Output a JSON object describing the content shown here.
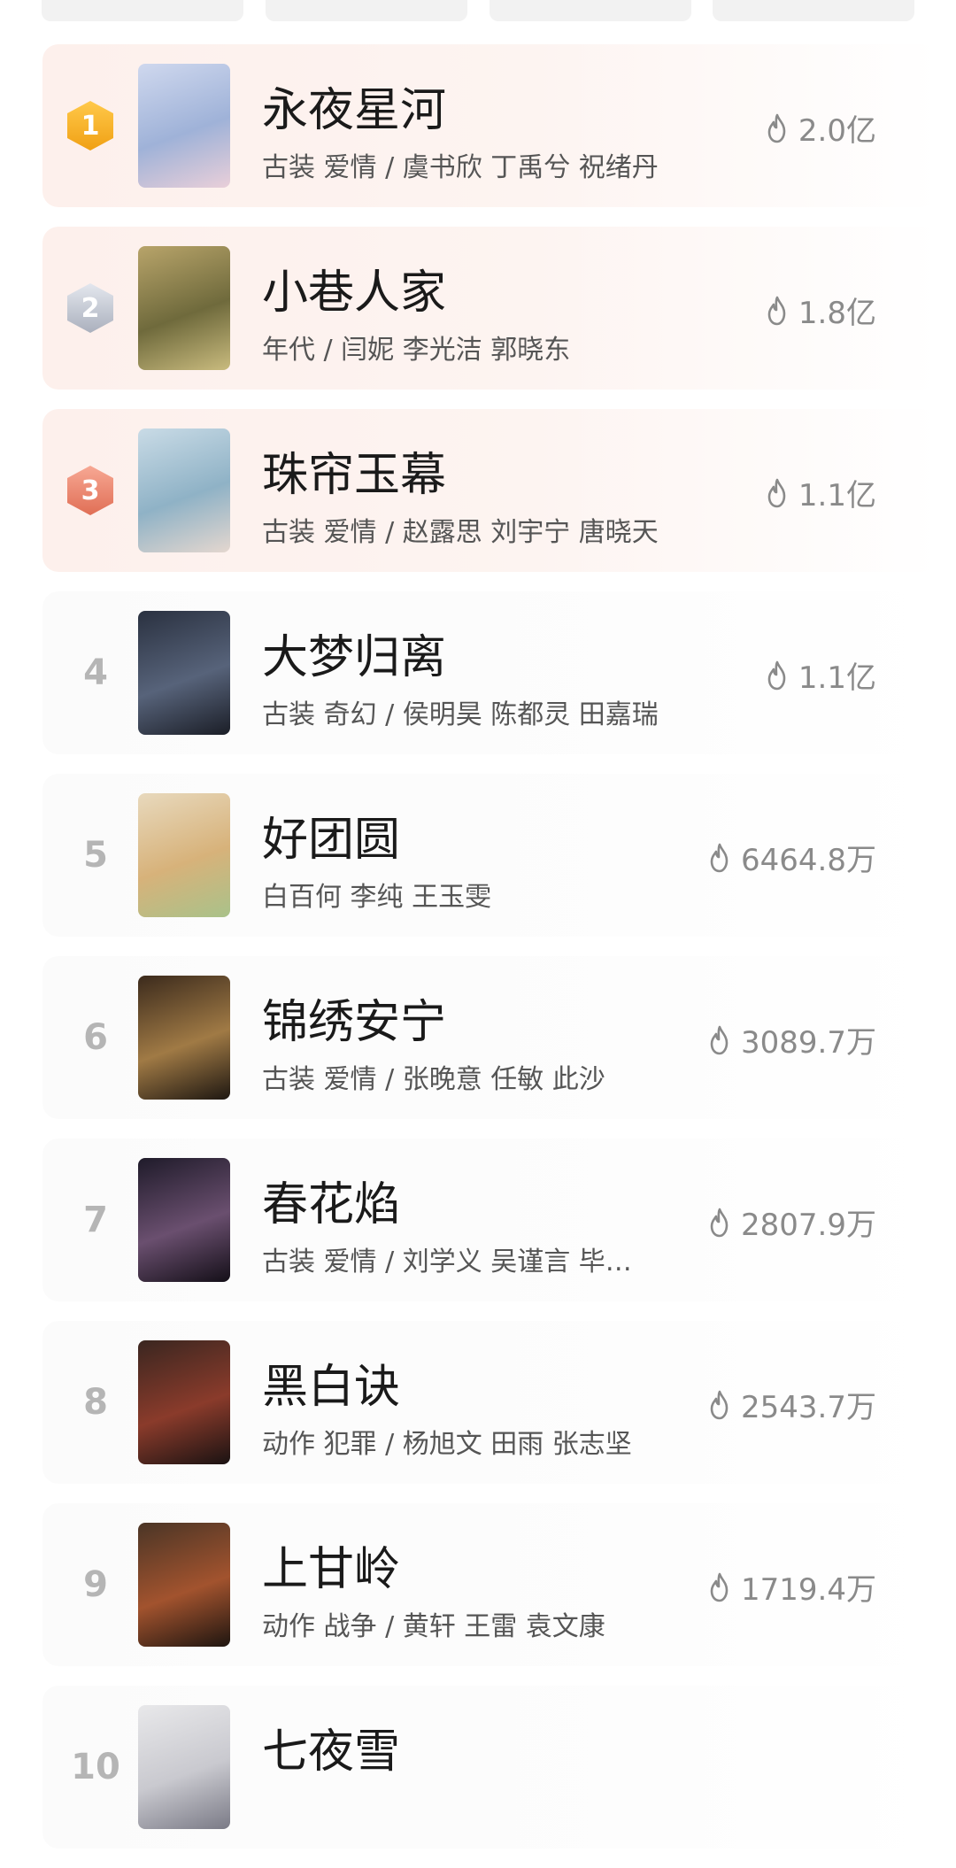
{
  "top_tabs": [
    {
      "label": ""
    },
    {
      "label": ""
    },
    {
      "label": ""
    },
    {
      "label": ""
    }
  ],
  "ranking": [
    {
      "rank": "1",
      "title": "永夜星河",
      "sub": "古装 爱情 / 虞书欣 丁禹兮 祝绪丹",
      "heat": "2.0亿",
      "medal": "gold",
      "poster_colors": [
        "#cfd8ee",
        "#9fb2d8",
        "#e9cfd9"
      ]
    },
    {
      "rank": "2",
      "title": "小巷人家",
      "sub": "年代 / 闫妮 李光洁 郭晓东",
      "heat": "1.8亿",
      "medal": "silver",
      "poster_colors": [
        "#b8a46a",
        "#6f6a3c",
        "#c9bb7e"
      ]
    },
    {
      "rank": "3",
      "title": "珠帘玉幕",
      "sub": "古装 爱情 / 赵露思 刘宇宁 唐晓天",
      "heat": "1.1亿",
      "medal": "bronze",
      "poster_colors": [
        "#c9dbe6",
        "#8fb2c6",
        "#e4d7cf"
      ]
    },
    {
      "rank": "4",
      "title": "大梦归离",
      "sub": "古装 奇幻 / 侯明昊 陈都灵 田嘉瑞",
      "heat": "1.1亿",
      "medal": "",
      "poster_colors": [
        "#2a3140",
        "#57637a",
        "#1b1e27"
      ]
    },
    {
      "rank": "5",
      "title": "好团圆",
      "sub": "白百何 李纯 王玉雯",
      "heat": "6464.8万",
      "medal": "",
      "poster_colors": [
        "#e8d9bd",
        "#d7b27a",
        "#a9c28a"
      ]
    },
    {
      "rank": "6",
      "title": "锦绣安宁",
      "sub": "古装 爱情 / 张晚意 任敏 此沙",
      "heat": "3089.7万",
      "medal": "",
      "poster_colors": [
        "#3b2a1c",
        "#a07a45",
        "#1e1711"
      ]
    },
    {
      "rank": "7",
      "title": "春花焰",
      "sub": "古装 爱情 / 刘学义 吴谨言 毕…",
      "heat": "2807.9万",
      "medal": "",
      "poster_colors": [
        "#1f1b2a",
        "#6a4f6f",
        "#140f18"
      ]
    },
    {
      "rank": "8",
      "title": "黑白诀",
      "sub": "动作 犯罪 / 杨旭文 田雨 张志坚",
      "heat": "2543.7万",
      "medal": "",
      "poster_colors": [
        "#3a2620",
        "#8a3b2b",
        "#1a1212"
      ]
    },
    {
      "rank": "9",
      "title": "上甘岭",
      "sub": "动作 战争 / 黄轩 王雷 袁文康",
      "heat": "1719.4万",
      "medal": "",
      "poster_colors": [
        "#4a3526",
        "#a2532e",
        "#1e1510"
      ]
    },
    {
      "rank": "10",
      "title": "七夜雪",
      "sub": "",
      "heat": "",
      "medal": "",
      "poster_colors": [
        "#e8e8ea",
        "#c9c9cf",
        "#7a7a86"
      ]
    }
  ],
  "colors": {
    "card_top": "#fdf0ec",
    "card": "#fbfbfb",
    "heat_text": "#8a8a8a",
    "rank_text": "#b5b5b5"
  }
}
